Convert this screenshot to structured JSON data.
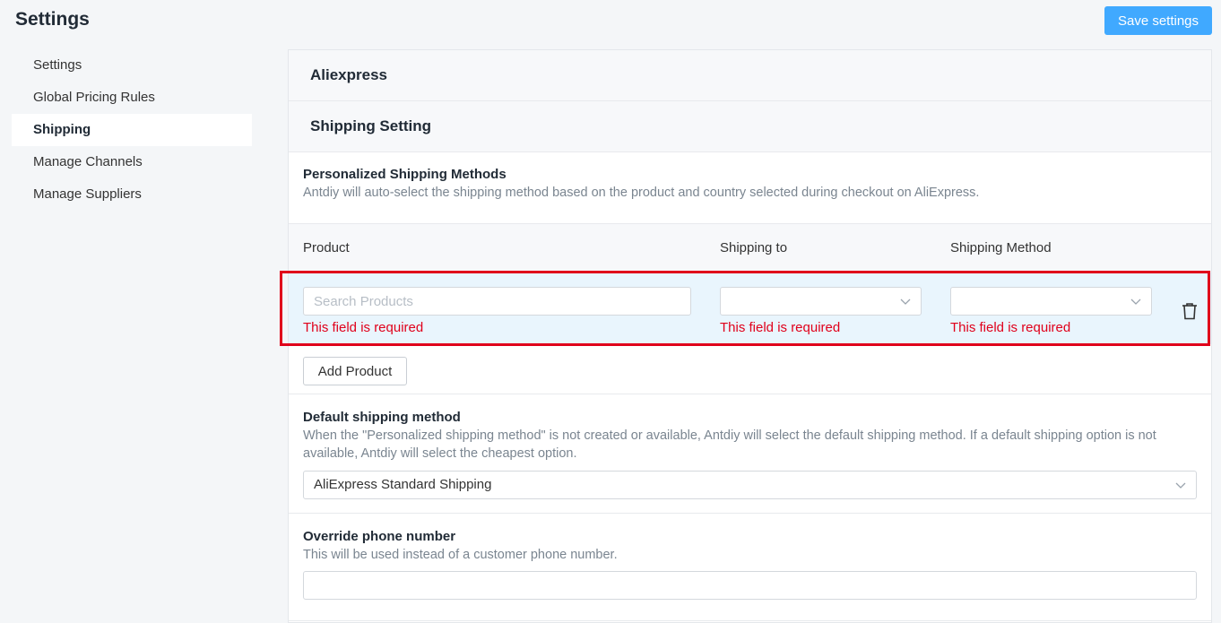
{
  "header": {
    "title": "Settings",
    "save_label": "Save settings",
    "accent_color": "#40a9ff"
  },
  "sidebar": {
    "items": [
      {
        "label": "Settings",
        "active": false
      },
      {
        "label": "Global Pricing Rules",
        "active": false
      },
      {
        "label": "Shipping",
        "active": true
      },
      {
        "label": "Manage Channels",
        "active": false
      },
      {
        "label": "Manage Suppliers",
        "active": false
      }
    ]
  },
  "main": {
    "platform_heading": "Aliexpress",
    "section_heading": "Shipping Setting",
    "personalized": {
      "title": "Personalized Shipping Methods",
      "description": "Antdiy will auto-select the shipping method based on the product and country selected during checkout on AliExpress."
    },
    "table": {
      "headers": [
        "Product",
        "Shipping to",
        "Shipping Method"
      ],
      "row": {
        "product_placeholder": "Search Products",
        "product_value": "",
        "shipping_to_value": "",
        "shipping_method_value": "",
        "error_text": "This field is required",
        "delete_icon": "trash-icon"
      },
      "error_color": "#e0001b"
    },
    "add_product_label": "Add Product",
    "default_method": {
      "title": "Default shipping method",
      "description": "When the \"Personalized shipping method\" is not created or available, Antdiy will select the default shipping method. If a default shipping option is not available, Antdiy will select the cheapest option.",
      "selected": "AliExpress Standard Shipping"
    },
    "phone": {
      "title": "Override phone number",
      "description": "This will be used instead of a customer phone number.",
      "value": ""
    }
  }
}
